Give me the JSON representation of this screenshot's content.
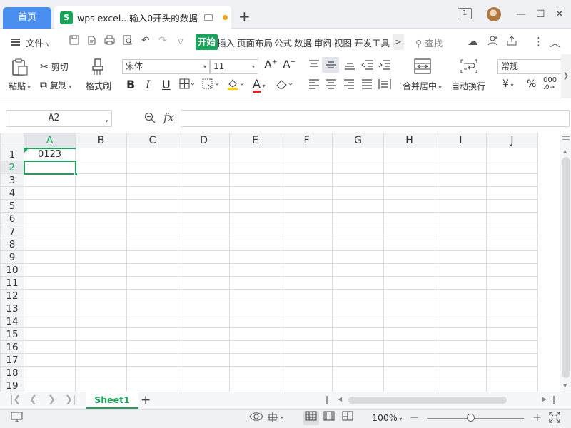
{
  "tabs": {
    "home": "首页",
    "doc_icon": "S",
    "doc_title": "wps excel...输入0开头的数据？",
    "new_tab": "+"
  },
  "window": {
    "counter_icon": "1",
    "minimize": "—",
    "restore": "☐",
    "close": "✕"
  },
  "menu": {
    "file": "文件",
    "items": [
      "开始",
      "插入",
      "页面布局",
      "公式",
      "数据",
      "审阅",
      "视图",
      "开发工具"
    ],
    "more": ">",
    "search": "查找"
  },
  "ribbon": {
    "paste": "粘贴",
    "cut": "剪切",
    "copy": "复制",
    "format_painter": "格式刷",
    "font_name": "宋体",
    "font_size": "11",
    "merge": "合并居中",
    "wrap": "自动换行",
    "number_format": "常规",
    "currency": "¥",
    "percent": "%",
    "bold": "B",
    "italic": "I",
    "underline": "U",
    "grow": "A",
    "shrink": "A",
    "font_color": "A",
    "thousands": "000"
  },
  "formula_bar": {
    "name_box": "A2",
    "fx": "fx",
    "value": ""
  },
  "sheet": {
    "columns": [
      "A",
      "B",
      "C",
      "D",
      "E",
      "F",
      "G",
      "H",
      "I",
      "J"
    ],
    "rows": [
      "1",
      "2",
      "3",
      "4",
      "5",
      "6",
      "7",
      "8",
      "9",
      "10",
      "11",
      "12",
      "13",
      "14",
      "15",
      "16",
      "17",
      "18",
      "19"
    ],
    "selected_column": "A",
    "selected_row": "2",
    "cells": {
      "A1": "0123"
    }
  },
  "sheet_tabs": {
    "active": "Sheet1",
    "add": "+"
  },
  "status": {
    "zoom": "100%",
    "zoom_level": 0.45
  },
  "colors": {
    "accent_green": "#1aa35a",
    "home_tab_blue": "#4a8ff0"
  }
}
